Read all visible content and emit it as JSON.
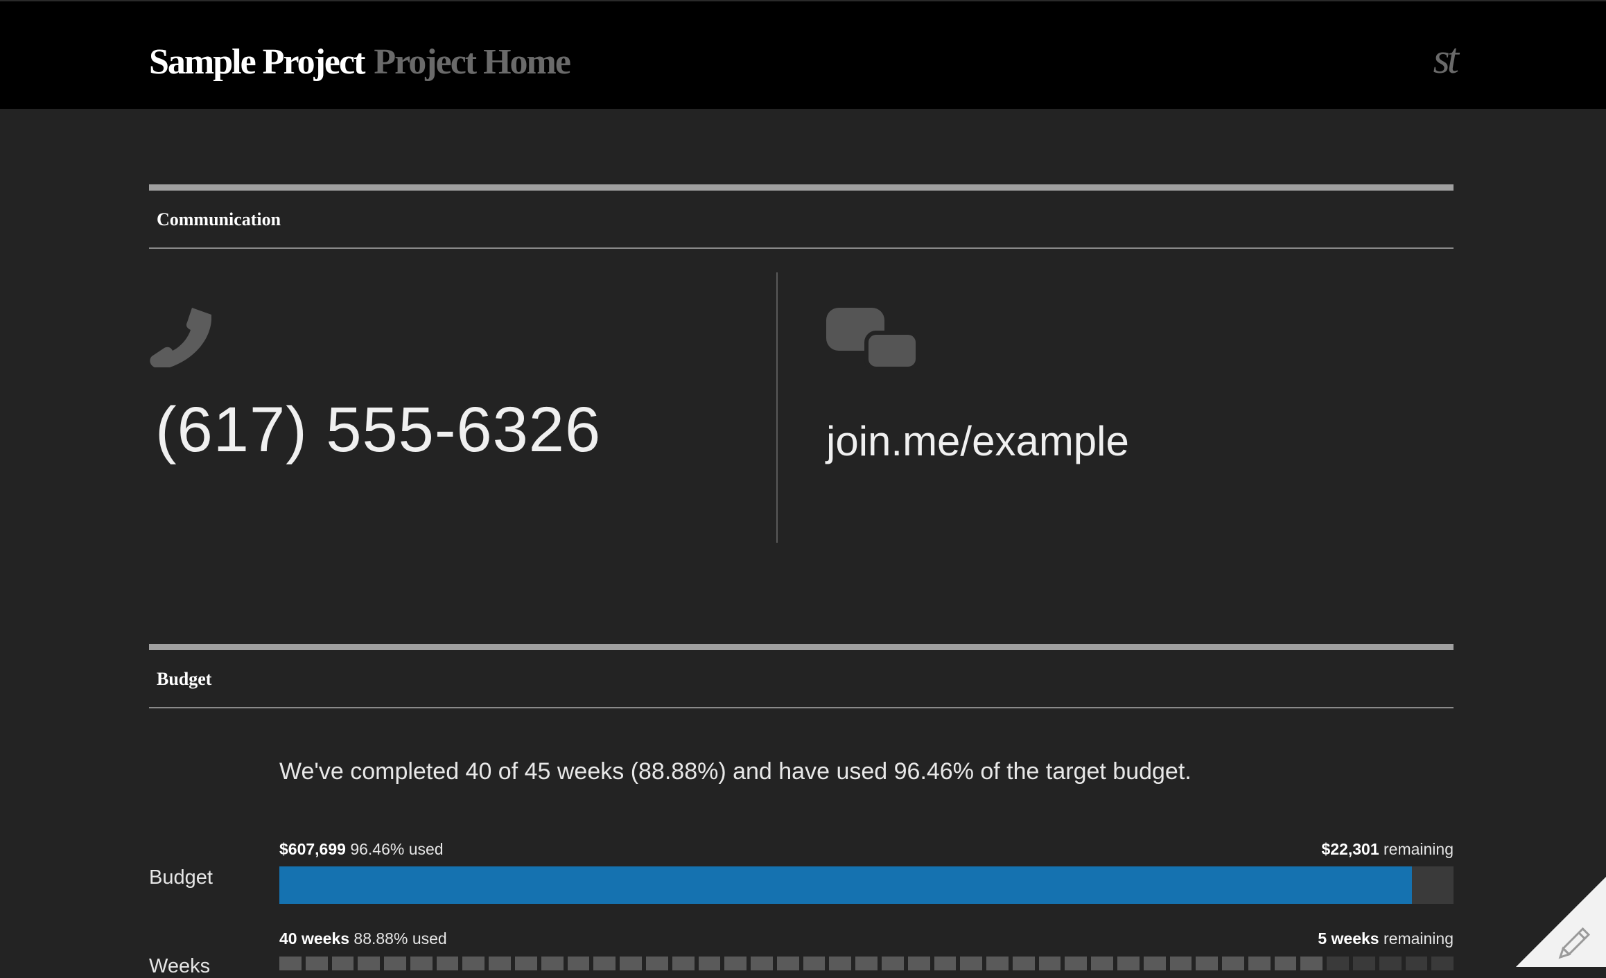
{
  "header": {
    "project_name": "Sample Project",
    "page_name": "Project Home",
    "logo_text": "st"
  },
  "communication": {
    "title": "Communication",
    "phone_icon": "phone-icon",
    "phone": "(617) 555-6326",
    "chat_icon": "chat-bubbles-icon",
    "meeting_link": "join.me/example"
  },
  "budget": {
    "title": "Budget",
    "summary": "We've completed 40 of 45 weeks (88.88%) and have used 96.46% of the target budget.",
    "budget_row": {
      "label": "Budget",
      "used_amount": "$607,699",
      "used_text": "96.46% used",
      "remaining_amount": "$22,301",
      "remaining_text": "remaining",
      "fill_percent": 96.46,
      "fill_color": "#1572b0"
    },
    "weeks_row": {
      "label": "Weeks",
      "used_amount": "40 weeks",
      "used_text": "88.88% used",
      "remaining_amount": "5 weeks",
      "remaining_text": "remaining",
      "weeks_total": 45,
      "weeks_completed": 40,
      "completed_color": "#5a5a5a",
      "remaining_color": "#3a3a3a"
    }
  },
  "edit_icon": "pencil-icon"
}
